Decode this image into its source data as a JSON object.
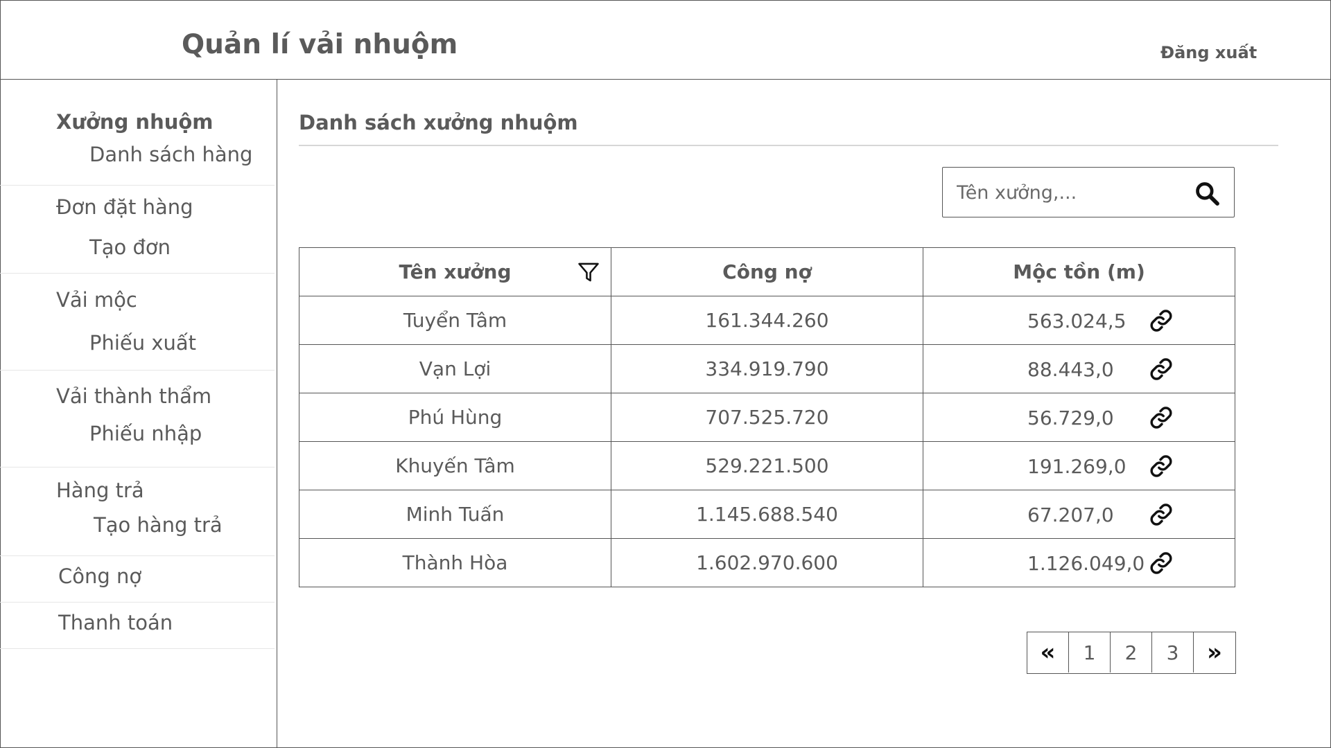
{
  "header": {
    "app_title": "Quản lí vải nhuộm",
    "logout_label": "Đăng xuất"
  },
  "sidebar": {
    "groups": [
      {
        "label": "Xưởng nhuộm",
        "active": true,
        "sub": "Danh sách hàng"
      },
      {
        "label": "Đơn đặt hàng",
        "sub": "Tạo đơn"
      },
      {
        "label": "Vải mộc",
        "sub": "Phiếu xuất"
      },
      {
        "label": "Vải thành thẩm",
        "sub": "Phiếu nhập"
      },
      {
        "label": "Hàng trả",
        "sub": "Tạo hàng trả"
      },
      {
        "label": "Công nợ"
      },
      {
        "label": "Thanh toán"
      }
    ]
  },
  "main": {
    "title": "Danh sách xưởng nhuộm",
    "search": {
      "placeholder": "Tên xưởng,..."
    },
    "table": {
      "columns": [
        "Tên xưởng",
        "Công nợ",
        "Mộc tồn (m)"
      ],
      "rows": [
        {
          "name": "Tuyển Tâm",
          "debt": "161.344.260",
          "stock": "563.024,5"
        },
        {
          "name": "Vạn Lợi",
          "debt": "334.919.790",
          "stock": "88.443,0"
        },
        {
          "name": "Phú Hùng",
          "debt": "707.525.720",
          "stock": "56.729,0"
        },
        {
          "name": "Khuyến Tâm",
          "debt": "529.221.500",
          "stock": "191.269,0"
        },
        {
          "name": "Minh Tuấn",
          "debt": "1.145.688.540",
          "stock": "67.207,0"
        },
        {
          "name": "Thành Hòa",
          "debt": "1.602.970.600",
          "stock": "1.126.049,0"
        }
      ]
    },
    "pagination": {
      "first": "«",
      "pages": [
        "1",
        "2",
        "3"
      ],
      "last": "»"
    }
  },
  "icons": {
    "search": "search-icon",
    "filter": "filter-icon",
    "link": "link-icon"
  }
}
